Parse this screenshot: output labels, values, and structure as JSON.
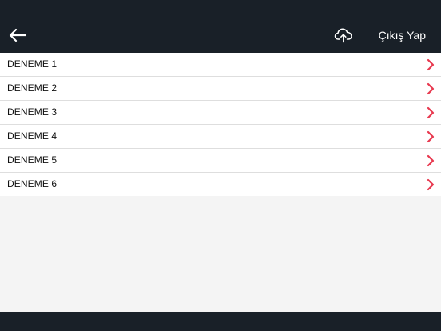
{
  "header": {
    "back_icon": "arrow-left-icon",
    "upload_icon": "cloud-upload-icon",
    "logout_label": "Çıkış Yap"
  },
  "list": {
    "items": [
      {
        "label": "DENEME 1"
      },
      {
        "label": "DENEME 2"
      },
      {
        "label": "DENEME 3"
      },
      {
        "label": "DENEME 4"
      },
      {
        "label": "DENEME 5"
      },
      {
        "label": "DENEME 6"
      }
    ]
  },
  "colors": {
    "bar": "#192028",
    "chevron": "#e8394f",
    "background": "#f4f4f4"
  }
}
